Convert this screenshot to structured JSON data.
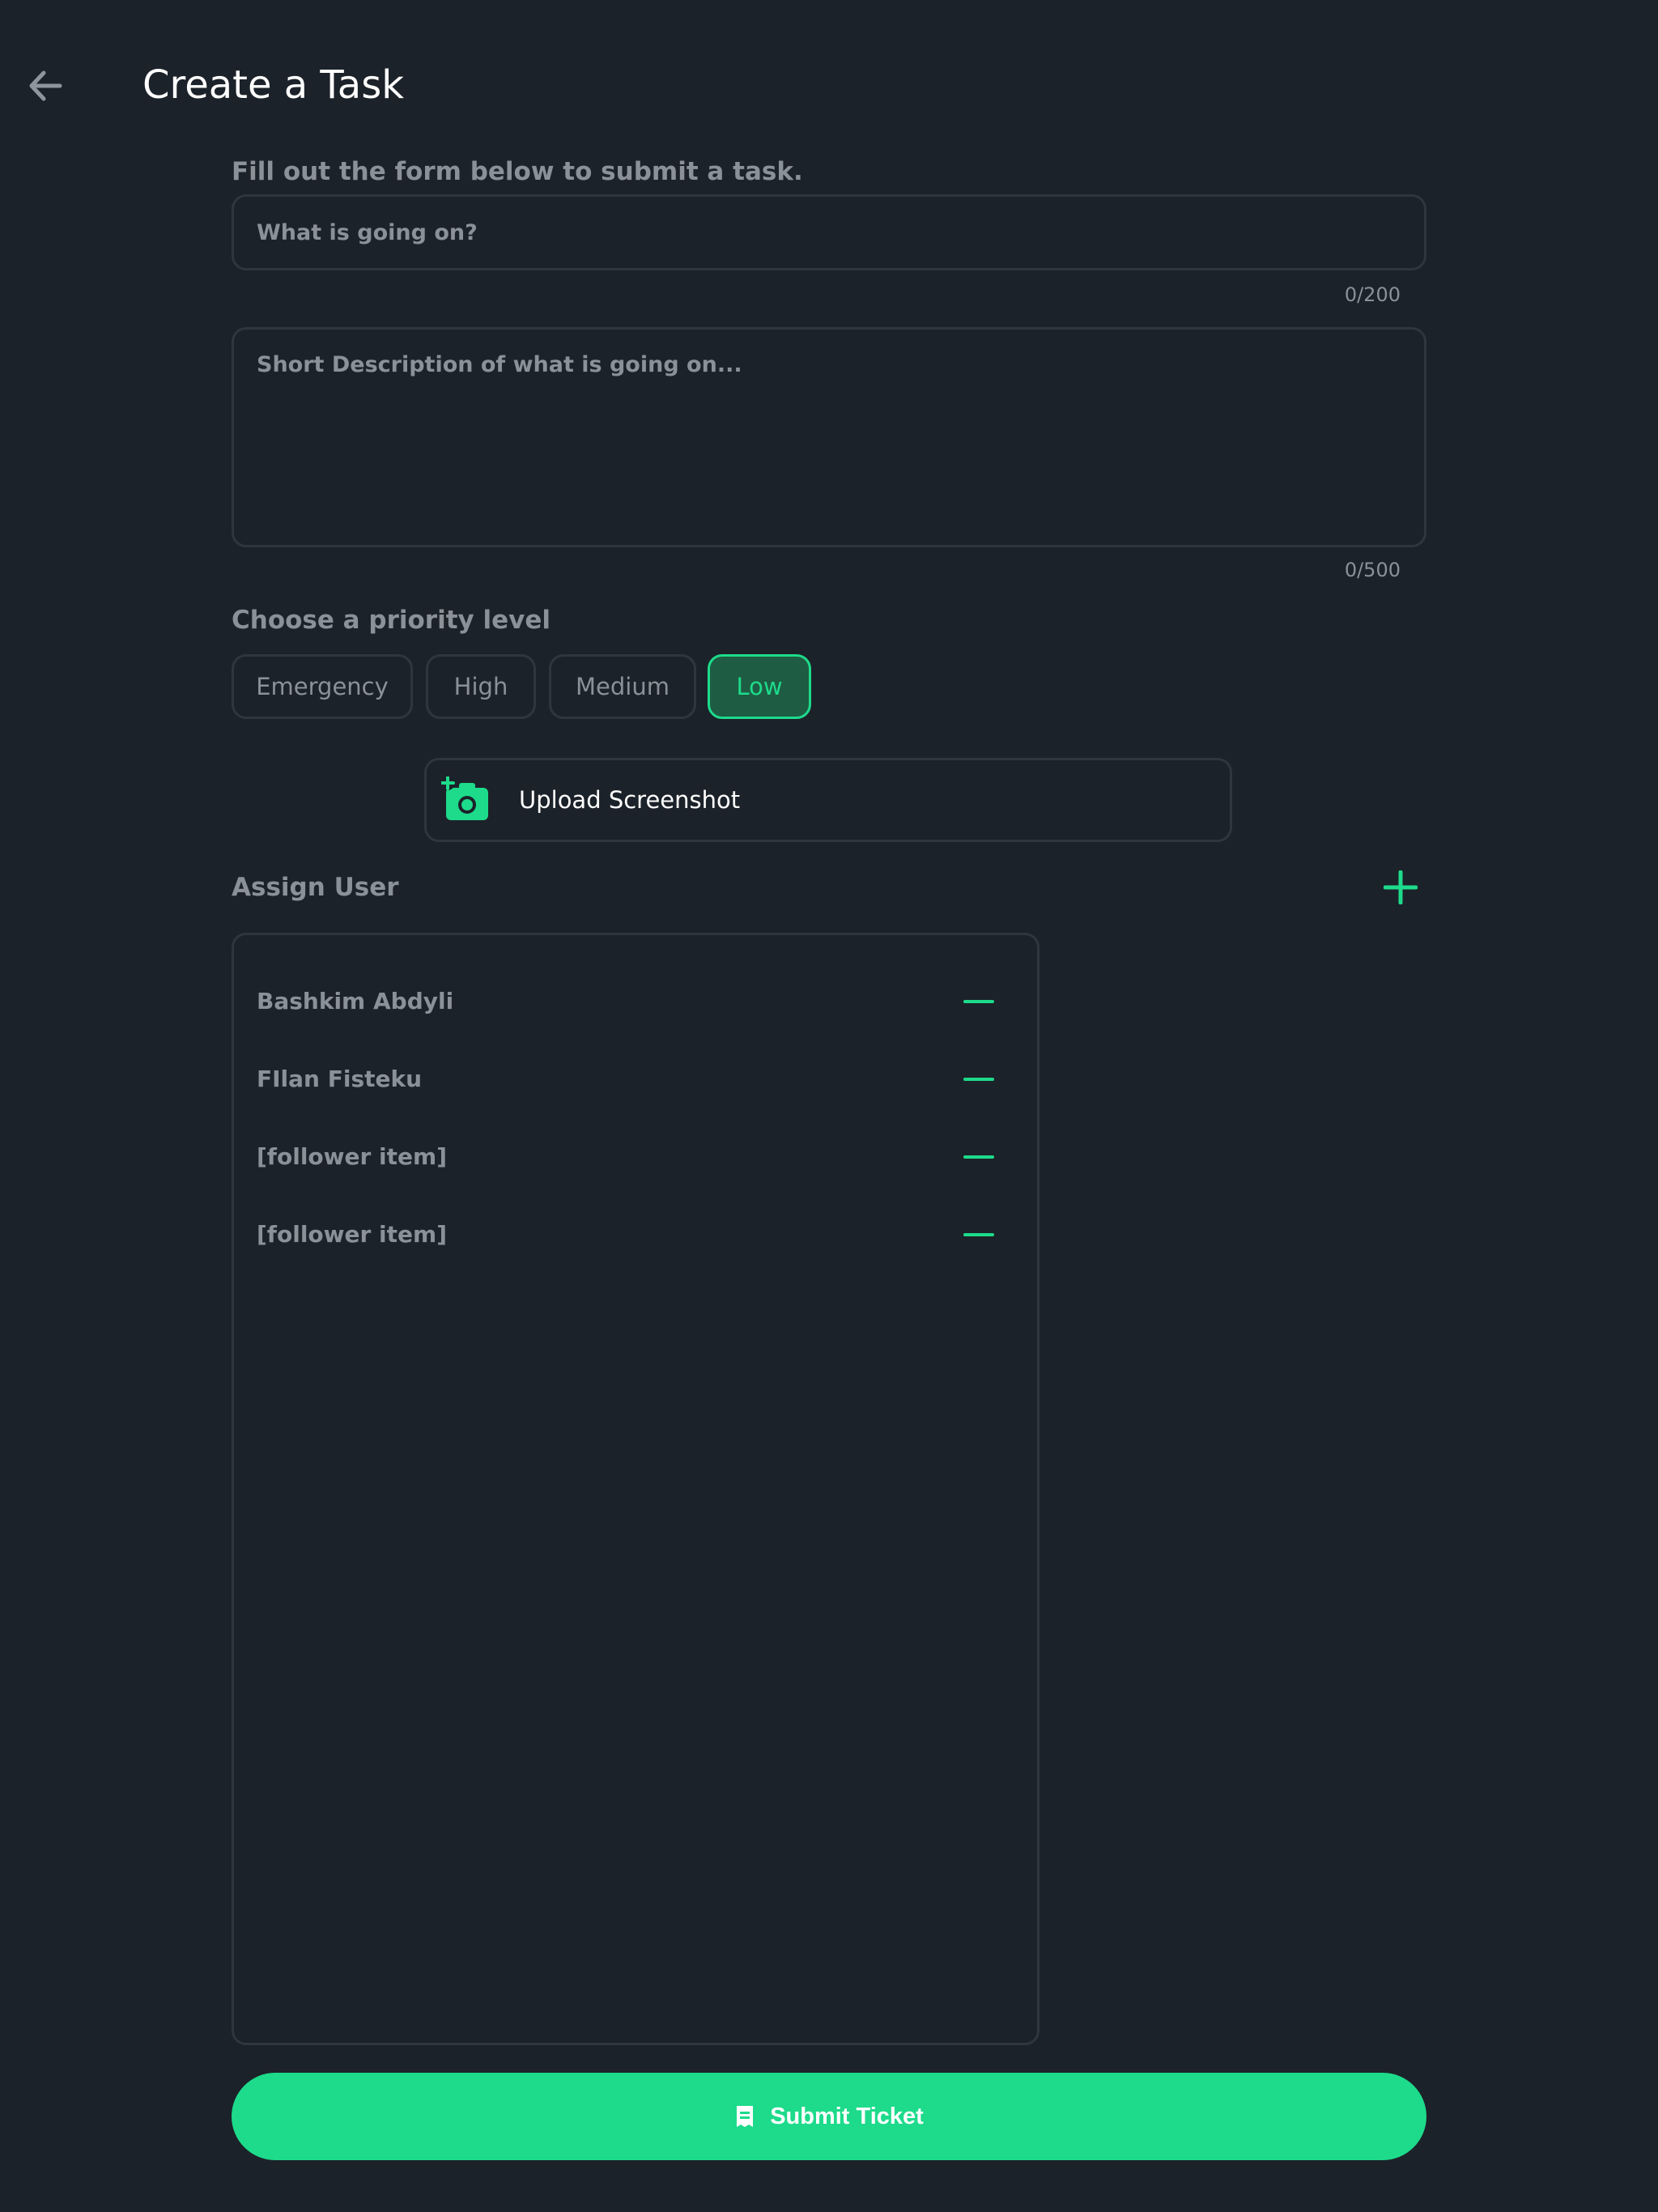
{
  "header": {
    "title": "Create a Task"
  },
  "form": {
    "intro": "Fill out the form below to submit a task.",
    "title_field": {
      "placeholder": "What is going on?",
      "value": "",
      "counter": "0/200"
    },
    "description_field": {
      "placeholder": "Short Description of what is going on...",
      "value": "",
      "counter": "0/500"
    }
  },
  "priority": {
    "label": "Choose a priority level",
    "options": [
      "Emergency",
      "High",
      "Medium",
      "Low"
    ],
    "selected": "Low"
  },
  "upload": {
    "label": "Upload Screenshot"
  },
  "assign": {
    "label": "Assign User",
    "users": [
      "Bashkim Abdyli",
      "FIlan Fisteku",
      "[follower item]",
      "[follower item]"
    ]
  },
  "submit": {
    "label": "Submit Ticket"
  },
  "colors": {
    "background": "#1c2229",
    "accent": "#1ddb8b",
    "border": "#2f363d",
    "muted_text": "#8a9198",
    "title_text": "#ffffff"
  },
  "icons": {
    "back": "arrow-left-icon",
    "upload": "camera-plus-icon",
    "add_user": "plus-icon",
    "remove_user": "minus-icon",
    "submit": "receipt-icon"
  }
}
